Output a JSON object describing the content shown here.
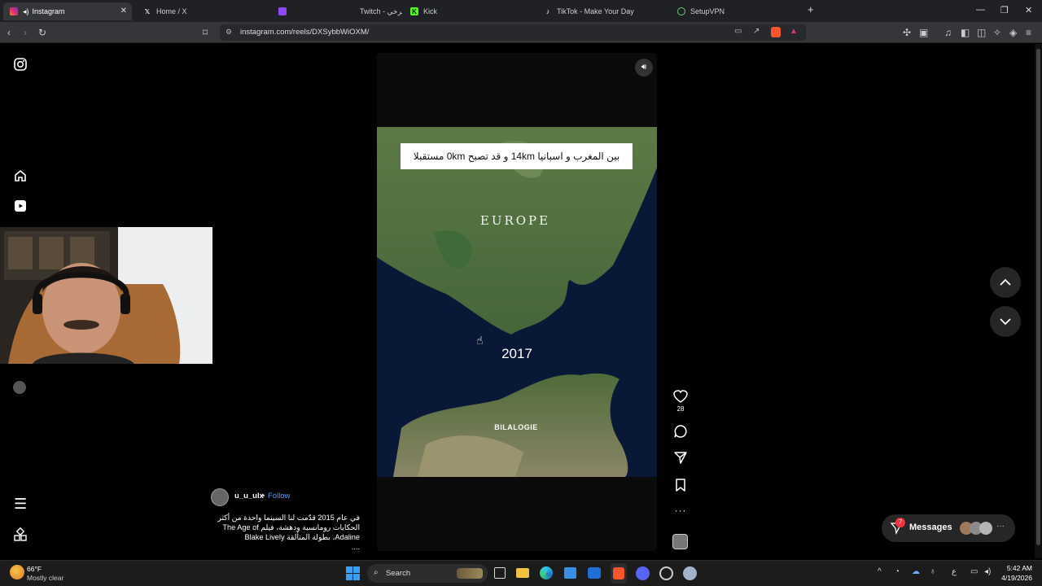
{
  "browser": {
    "tabs": [
      {
        "label": "Instagram",
        "icon": "instagram-icon",
        "active": true
      },
      {
        "label": "Home / X",
        "icon": "x-icon",
        "active": false
      },
      {
        "label": "Twitch - صرخي",
        "icon": "twitch-icon",
        "active": false
      },
      {
        "label": "Kick",
        "icon": "kick-icon",
        "active": false
      },
      {
        "label": "TikTok - Make Your Day",
        "icon": "tiktok-icon",
        "active": false
      },
      {
        "label": "SetupVPN",
        "icon": "vpn-icon",
        "active": false
      }
    ],
    "url": "instagram.com/reels/DXSybbWiOXM/"
  },
  "reel": {
    "overlay_text": "بين المغرب و اسبانيا 14km و قد تصبح 0km مستقبلا",
    "map_label_top": "EUROPE",
    "year": "2017",
    "watermark": "BILALOGIE",
    "likes": "28"
  },
  "post": {
    "username": "u_u_ulx",
    "separator": "•",
    "follow_label": "Follow",
    "caption_line1": "في عام 2015 قدّمت لنا السينما واحدة من أكثر",
    "caption_line2": "الحكايات رومانسية ودهشة، فيلم The Age of",
    "caption_line3": "Adaline، بطولة المتألقة Blake Lively",
    "caption_more": "...."
  },
  "messages": {
    "label": "Messages",
    "badge": "7"
  },
  "taskbar": {
    "temp": "66°F",
    "weather": "Mostly clear",
    "search_placeholder": "Search",
    "time": "5:42 AM",
    "date": "4/19/2026",
    "lang": "ع"
  },
  "colors": {
    "accent_blue": "#4a9ff5",
    "brave_orange": "#fb542b",
    "badge_red": "#ff3040"
  }
}
